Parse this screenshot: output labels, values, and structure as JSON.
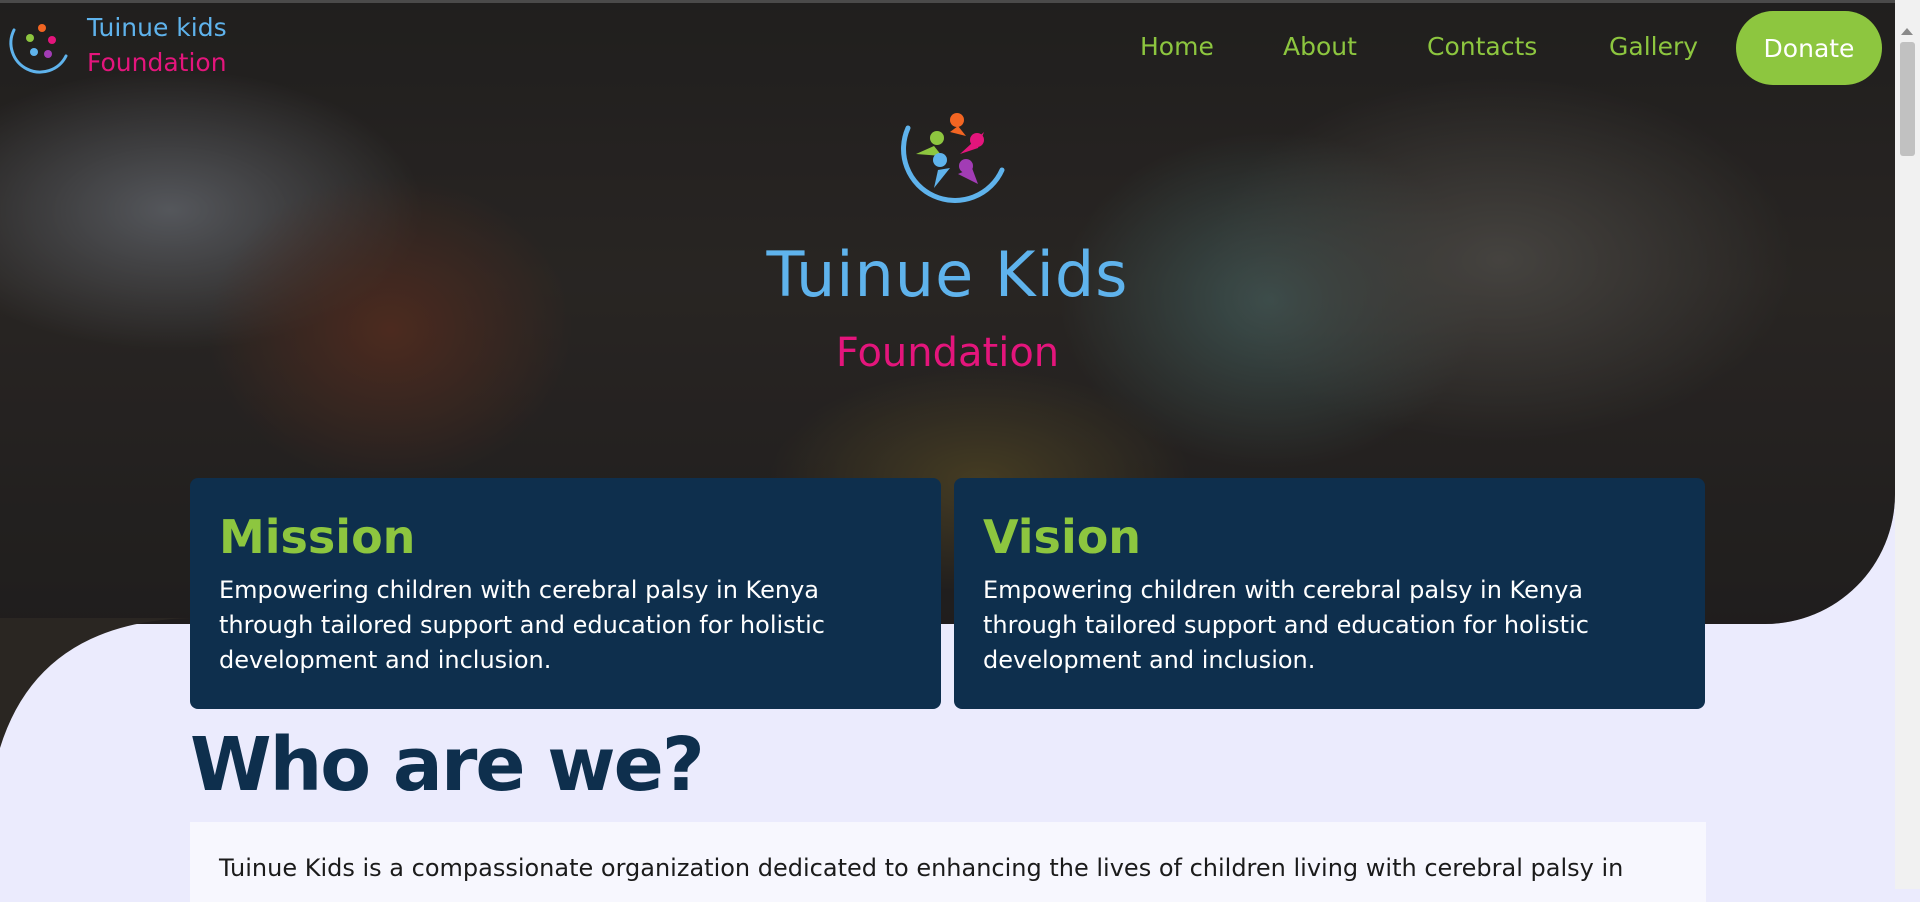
{
  "brand": {
    "name_line1": "Tuinue kids",
    "name_line2": "Foundation"
  },
  "nav": {
    "links": [
      "Home",
      "About",
      "Contacts",
      "Gallery"
    ],
    "donate_label": "Donate"
  },
  "hero": {
    "title": "Tuinue Kids",
    "subtitle": "Foundation"
  },
  "cards": {
    "mission": {
      "title": "Mission",
      "lines": [
        "Empowering children with cerebral palsy in Kenya",
        "through tailored support and education for holistic",
        "development and inclusion."
      ]
    },
    "vision": {
      "title": "Vision",
      "lines": [
        "Empowering children with cerebral palsy in Kenya",
        "through tailored support and education for holistic",
        "development and inclusion."
      ]
    }
  },
  "about": {
    "heading": "Who are we?",
    "text": "Tuinue Kids is a compassionate organization dedicated to enhancing the lives of children living with cerebral palsy in"
  },
  "colors": {
    "accent_green": "#8dc63f",
    "brand_blue": "#5fb3ec",
    "brand_pink": "#e4157c",
    "navy": "#0e2f4d",
    "page_bg": "#ebebfd"
  },
  "icons": [
    "logo-icon",
    "scroll-up-arrow-icon"
  ]
}
